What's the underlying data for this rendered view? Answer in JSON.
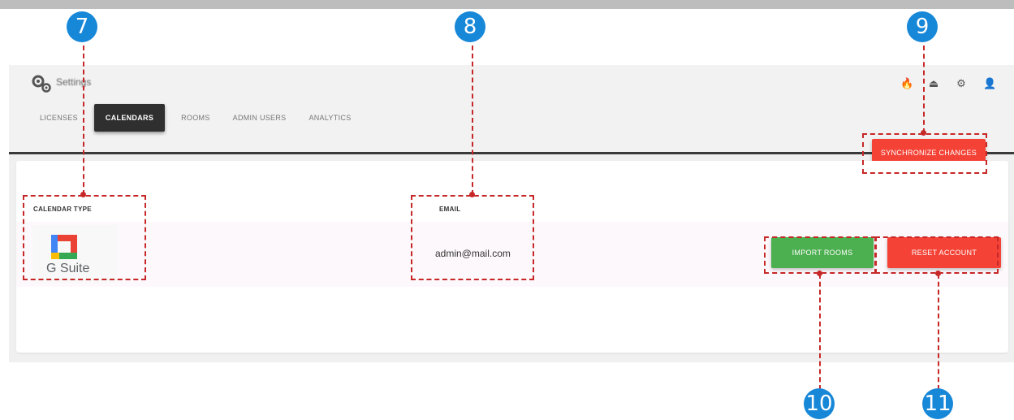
{
  "header": {
    "title": "Settings",
    "icons": [
      "firebase-icon",
      "upload-icon",
      "settings-icon",
      "user-icon"
    ]
  },
  "tabs": [
    {
      "label": "LICENSES"
    },
    {
      "label": "CALENDARS",
      "active": true
    },
    {
      "label": "ROOMS"
    },
    {
      "label": "ADMIN USERS"
    },
    {
      "label": "ANALYTICS"
    }
  ],
  "sync_button": "SYNCHRONIZE CHANGES",
  "table": {
    "columns": [
      "CALENDAR TYPE",
      "EMAIL"
    ],
    "rows": [
      {
        "calendar_type": "G Suite",
        "email": "admin@mail.com",
        "import_button": "IMPORT ROOMS",
        "reset_button": "RESET ACCOUNT"
      }
    ]
  },
  "annotations": {
    "markers": [
      "7",
      "8",
      "9",
      "10",
      "11"
    ]
  },
  "colors": {
    "primary_red": "#f44336",
    "green": "#4caf50",
    "active_tab": "#2f2f2f",
    "marker_blue": "#1787d8",
    "annotation_red": "#c62828"
  }
}
